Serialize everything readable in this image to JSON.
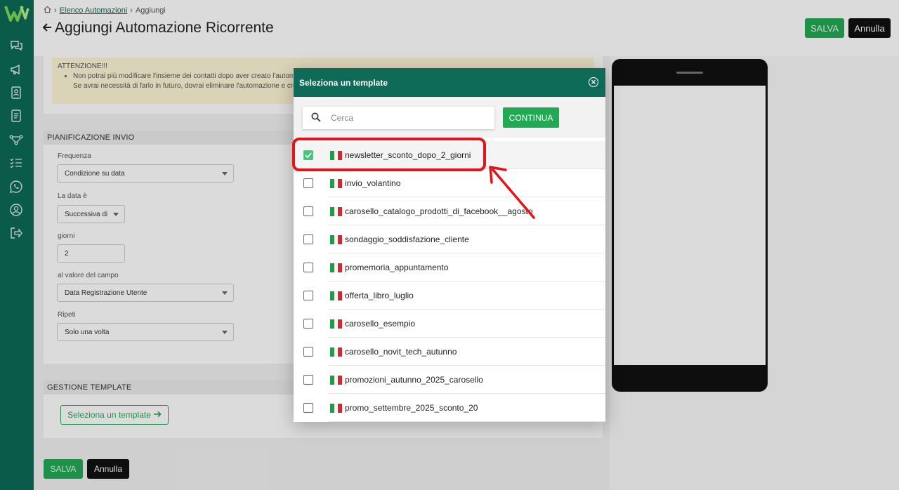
{
  "breadcrumb": {
    "link": "Elenco Automazioni",
    "current": "Aggiungi"
  },
  "page": {
    "title": "Aggiungi Automazione Ricorrente"
  },
  "header_actions": {
    "save": "SALVA",
    "cancel": "Annulla"
  },
  "warning": {
    "title": "ATTENZIONE!!!",
    "line1": "Non potrai più modificare l'insieme dei contatti dopo aver creato l'automa",
    "line2": "Se avrai necessità di farlo in futuro, dovrai eliminare l'automazione e crea"
  },
  "planning": {
    "title": "PIANIFICAZIONE INVIO",
    "frequency_label": "Frequenza",
    "frequency_value": "Condizione su data",
    "date_label": "La data è",
    "date_value": "Successiva di",
    "days_label": "giorni",
    "days_value": "2",
    "field_label": "al valore del campo",
    "field_value": "Data Registrazione Utente",
    "repeat_label": "Ripeti",
    "repeat_value": "Solo una volta"
  },
  "template_section": {
    "title": "GESTIONE TEMPLATE",
    "select_button": "Seleziona un template"
  },
  "footer_actions": {
    "save": "SALVA",
    "cancel": "Annulla"
  },
  "modal": {
    "title": "Seleziona un template",
    "search_placeholder": "Cerca",
    "continue_button": "CONTINUA",
    "templates": [
      {
        "name": "newsletter_sconto_dopo_2_giorni",
        "checked": true
      },
      {
        "name": "invio_volantino",
        "checked": false
      },
      {
        "name": "carosello_catalogo_prodotti_di_facebook__agosto",
        "checked": false
      },
      {
        "name": "sondaggio_soddisfazione_cliente",
        "checked": false
      },
      {
        "name": "promemoria_appuntamento",
        "checked": false
      },
      {
        "name": "offerta_libro_luglio",
        "checked": false
      },
      {
        "name": "carosello_esempio",
        "checked": false
      },
      {
        "name": "carosello_novit_tech_autunno",
        "checked": false
      },
      {
        "name": "promozioni_autunno_2025_carosello",
        "checked": false
      },
      {
        "name": "promo_settembre_2025_sconto_20",
        "checked": false
      }
    ]
  },
  "colors": {
    "brand": "#0d6b58",
    "accent": "#22a954",
    "highlight": "#e3131a"
  },
  "icons": [
    "chat-icon",
    "megaphone-icon",
    "contacts-icon",
    "document-icon",
    "workflow-icon",
    "checklist-icon",
    "whatsapp-icon",
    "user-icon",
    "logout-icon"
  ]
}
